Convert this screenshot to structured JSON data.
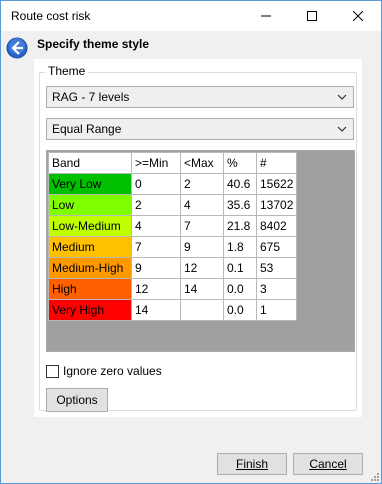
{
  "window": {
    "title": "Route cost risk"
  },
  "header": {
    "title": "Specify theme style"
  },
  "theme": {
    "legend": "Theme",
    "scheme": "RAG - 7 levels",
    "method": "Equal Range"
  },
  "table": {
    "headers": [
      "Band",
      ">=Min",
      "<Max",
      "%",
      "#"
    ],
    "rows": [
      {
        "band": "Very Low",
        "color": "#00c000",
        "min": "0",
        "max": "2",
        "pct": "40.6",
        "count": "15622"
      },
      {
        "band": "Low",
        "color": "#80ff00",
        "min": "2",
        "max": "4",
        "pct": "35.6",
        "count": "13702"
      },
      {
        "band": "Low-Medium",
        "color": "#c0ff00",
        "min": "4",
        "max": "7",
        "pct": "21.8",
        "count": "8402"
      },
      {
        "band": "Medium",
        "color": "#ffc000",
        "min": "7",
        "max": "9",
        "pct": "1.8",
        "count": "675"
      },
      {
        "band": "Medium-High",
        "color": "#ff9900",
        "min": "9",
        "max": "12",
        "pct": "0.1",
        "count": "53"
      },
      {
        "band": "High",
        "color": "#ff6000",
        "min": "12",
        "max": "14",
        "pct": "0.0",
        "count": "3"
      },
      {
        "band": "Very High",
        "color": "#ff0000",
        "min": "14",
        "max": "",
        "pct": "0.0",
        "count": "1"
      }
    ]
  },
  "ignore_zero": {
    "label": "Ignore zero values",
    "checked": false
  },
  "buttons": {
    "options": "Options",
    "finish": "Finish",
    "cancel": "Cancel"
  }
}
